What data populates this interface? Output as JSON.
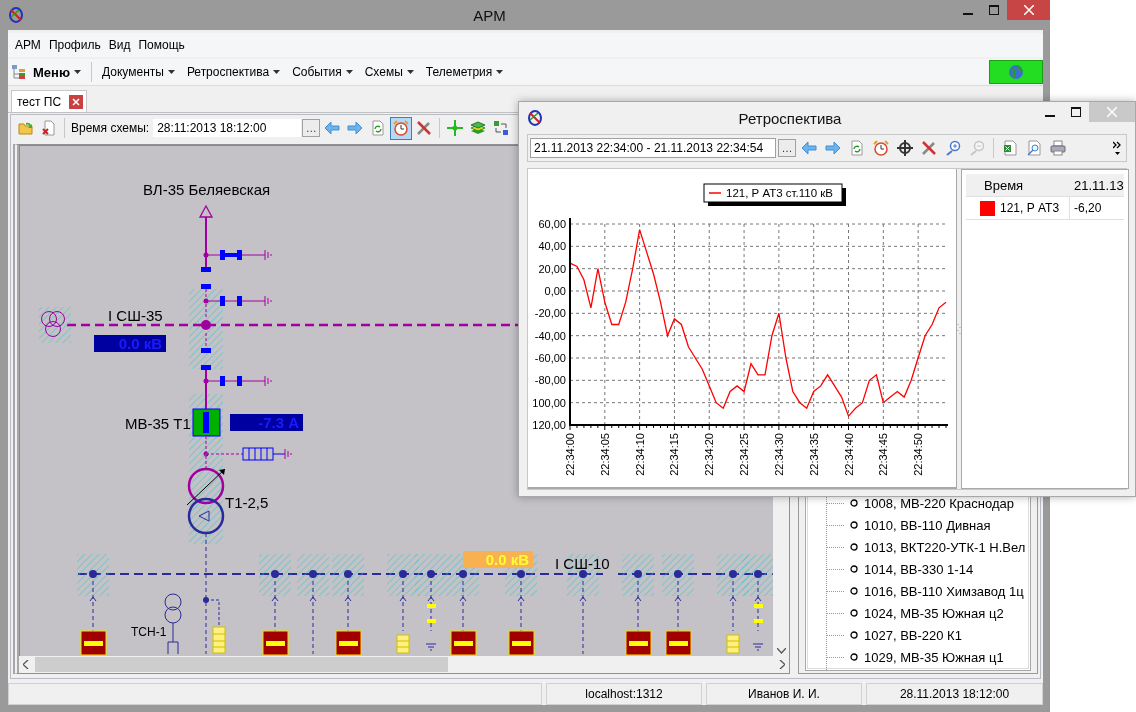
{
  "window": {
    "title": "АРМ"
  },
  "menu": [
    "АРМ",
    "Профиль",
    "Вид",
    "Помощь"
  ],
  "toolbar": {
    "main_menu": "Меню",
    "items": [
      "Документы",
      "Ретроспектива",
      "События",
      "Схемы",
      "Телеметрия"
    ]
  },
  "tabs": [
    {
      "label": "тест ПС",
      "selected": true
    }
  ],
  "schema_toolbar": {
    "time_label": "Время схемы:",
    "time_value": "28:11:2013 18:12:00",
    "browse": "…",
    "buttons_left": [
      {
        "kind": "open",
        "pressed": false
      },
      {
        "kind": "close-doc",
        "pressed": false
      }
    ],
    "buttons": [
      {
        "kind": "back",
        "pressed": false
      },
      {
        "kind": "forward",
        "pressed": false
      },
      {
        "kind": "refresh",
        "pressed": false
      },
      {
        "kind": "clock",
        "pressed": true
      },
      {
        "kind": "tools",
        "pressed": false
      },
      {
        "kind": "separator"
      },
      {
        "kind": "target",
        "pressed": false
      },
      {
        "kind": "layers",
        "pressed": false
      },
      {
        "kind": "switch",
        "pressed": false
      }
    ]
  },
  "schematic": {
    "line_name": "ВЛ-35 Беляевская",
    "bus_35": "I СШ-35",
    "bus_35_reading": "0.0 кВ",
    "breaker_name": "МВ-35 Т1",
    "breaker_reading": "-7.3 А",
    "transformer_name": "Т1-2,5",
    "bus_10_reading": "0.0 кВ",
    "bus_10": "I СШ-10",
    "aux_transformer": "ТСН-1"
  },
  "tree": {
    "items": [
      "1008, МВ-220 Краснодар",
      "1010, ВВ-110 Дивная",
      "1013, ВКТ220-УТК-1 Н.Вел",
      "1014, ВВ-330 1-14",
      "1016, ВВ-110 Химзавод 1ц",
      "1024, МВ-35 Южная  ц2",
      "1027, ВВ-220 К1",
      "1029, МВ-35 Южная  ц1"
    ]
  },
  "status_bar": [
    "localhost:1312",
    "Иванов И. И.",
    "28.11.2013 18:12:00"
  ],
  "retro_window": {
    "title": "Ретроспектива",
    "period": "21.11.2013 22:34:00 - 21.11.2013 22:34:54",
    "browse": "…",
    "buttons": [
      {
        "kind": "back",
        "disabled": false
      },
      {
        "kind": "forward",
        "disabled": false
      },
      {
        "kind": "refresh",
        "disabled": false
      },
      {
        "kind": "clock",
        "disabled": false
      },
      {
        "kind": "crosshair",
        "disabled": false
      },
      {
        "kind": "tools",
        "disabled": false
      },
      {
        "kind": "zoom-in",
        "disabled": false
      },
      {
        "kind": "zoom-out",
        "disabled": true
      },
      {
        "kind": "separator"
      },
      {
        "kind": "excel",
        "disabled": false
      },
      {
        "kind": "preview",
        "disabled": false
      },
      {
        "kind": "print",
        "disabled": false
      }
    ],
    "chart_data": {
      "type": "line",
      "grid": true,
      "categories": [
        "22:34:00",
        null,
        null,
        null,
        null,
        "22:34:05",
        null,
        null,
        null,
        null,
        "22:34:10",
        null,
        null,
        null,
        null,
        "22:34:15",
        null,
        null,
        null,
        null,
        "22:34:20",
        null,
        null,
        null,
        null,
        "22:34:25",
        null,
        null,
        null,
        null,
        "22:34:30",
        null,
        null,
        null,
        null,
        "22:34:35",
        null,
        null,
        null,
        null,
        "22:34:40",
        null,
        null,
        null,
        null,
        "22:34:45",
        null,
        null,
        null,
        null,
        "22:34:50",
        null,
        null,
        null,
        null
      ],
      "series": [
        {
          "name": "121, Р АТ3 ст.110 кВ",
          "color": "#ff0000",
          "values": [
            25,
            22,
            10,
            -15,
            20,
            -10,
            -30,
            -30,
            -10,
            20,
            55,
            35,
            15,
            -10,
            -40,
            -25,
            -30,
            -50,
            -60,
            -70,
            -85,
            -100,
            -105,
            -90,
            -85,
            -90,
            -65,
            -75,
            -75,
            -40,
            -20,
            -60,
            -90,
            -100,
            -105,
            -90,
            -85,
            -75,
            -85,
            -95,
            -112,
            -105,
            -100,
            -80,
            -75,
            -100,
            -95,
            -90,
            -95,
            -80,
            -60,
            -40,
            -30,
            -15,
            -10
          ]
        }
      ],
      "ylim": [
        -120,
        60
      ],
      "yticks": [
        {
          "value": 60,
          "label": "60,00"
        },
        {
          "value": 40,
          "label": "40,00"
        },
        {
          "value": 20,
          "label": "20,00"
        },
        {
          "value": 0,
          "label": "0,00"
        },
        {
          "value": -20,
          "label": "-20,00"
        },
        {
          "value": -40,
          "label": "-40,00"
        },
        {
          "value": -60,
          "label": "-60,00"
        },
        {
          "value": -80,
          "label": "-80,00"
        },
        {
          "value": -100,
          "label": "100,00"
        },
        {
          "value": -120,
          "label": "120,00"
        }
      ]
    },
    "table": {
      "columns": [
        "Время",
        "21.11.13"
      ],
      "rows": [
        {
          "name": "121, Р АТ3",
          "color": "#ff0000",
          "value": "-6,20"
        }
      ]
    }
  }
}
